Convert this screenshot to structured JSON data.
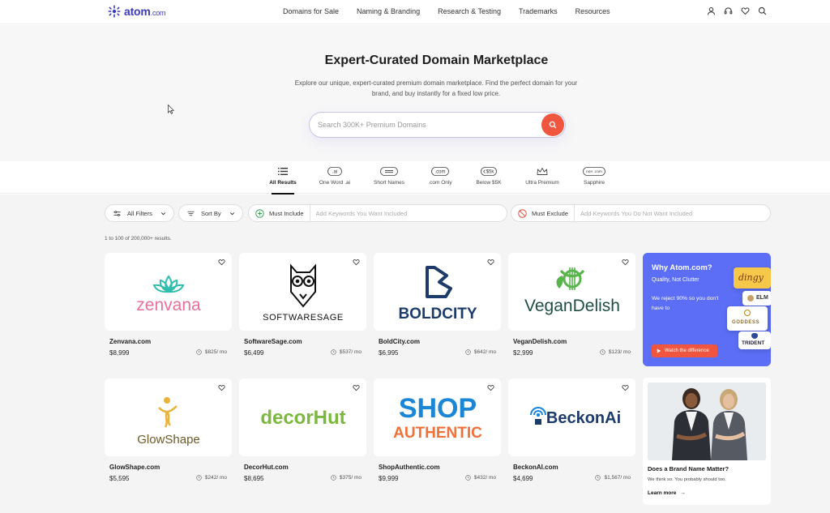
{
  "brand": {
    "name": "atom",
    "tld": ".com"
  },
  "nav": {
    "links": [
      "Domains for Sale",
      "Naming & Branding",
      "Research & Testing",
      "Trademarks",
      "Resources"
    ],
    "icons": [
      "user-icon",
      "headset-icon",
      "heart-icon",
      "search-icon"
    ]
  },
  "hero": {
    "title": "Expert-Curated Domain Marketplace",
    "subtitle": "Explore our unique, expert-curated premium domain marketplace. Find the perfect domain for your brand, and buy instantly for a fixed low price.",
    "search_placeholder": "Search 300K+ Premium Domains"
  },
  "tabs": [
    {
      "label": "All Results",
      "icon": "list-icon",
      "active": true
    },
    {
      "label": "One Word .ai",
      "icon": "ai-badge-icon",
      "badge": ".ai",
      "active": false
    },
    {
      "label": "Short Names",
      "icon": "short-name-icon",
      "active": false
    },
    {
      "label": ".com Only",
      "icon": "com-badge-icon",
      "badge": ".com",
      "active": false
    },
    {
      "label": "Below $5K",
      "icon": "price-tag-icon",
      "badge": "$5k",
      "active": false
    },
    {
      "label": "Ultra Premium",
      "icon": "crown-icon",
      "active": false
    },
    {
      "label": "Sapphire",
      "icon": "non-com-badge-icon",
      "badge": "non .com",
      "active": false
    }
  ],
  "filters": {
    "all_filters": "All Filters",
    "sort_by": "Sort By",
    "must_include": "Must Include",
    "include_placeholder": "Add Keywords You Want Included",
    "must_exclude": "Must Exclude",
    "exclude_placeholder": "Add Keywords You Do Not Want Included"
  },
  "results_count": "1 to 100 of 200,000+ results.",
  "cards": [
    {
      "name": "Zenvana.com",
      "price": "$8,999",
      "monthly": "$825/ mo",
      "logo_text": "zenvana"
    },
    {
      "name": "SoftwareSage.com",
      "price": "$6,499",
      "monthly": "$537/ mo",
      "logo_text": "SOFTWARESAGE"
    },
    {
      "name": "BoldCity.com",
      "price": "$6,995",
      "monthly": "$642/ mo",
      "logo_text": "BOLDCITY"
    },
    {
      "name": "VeganDelish.com",
      "price": "$2,999",
      "monthly": "$123/ mo",
      "logo_text": "VeganDelish"
    },
    {
      "name": "GlowShape.com",
      "price": "$5,595",
      "monthly": "$242/ mo",
      "logo_text": "GlowShape"
    },
    {
      "name": "DecorHut.com",
      "price": "$8,695",
      "monthly": "$375/ mo",
      "logo_text": "decorHut"
    },
    {
      "name": "ShopAuthentic.com",
      "price": "$9,999",
      "monthly": "$432/ mo",
      "logo_text_1": "SHOP",
      "logo_text_2": "AUTHENTIC"
    },
    {
      "name": "BeckonAI.com",
      "price": "$4,699",
      "monthly": "$1,567/ mo",
      "logo_text": "BeckonAi"
    }
  ],
  "promo": {
    "title": "Why Atom.com?",
    "subtitle": "Quality, Not Clutter",
    "body": "We reject 90% so you don't have to",
    "button": "Watch the difference",
    "mini_logos": [
      "dingy",
      "ELM",
      "GODDESS",
      "TRIDENT"
    ]
  },
  "article": {
    "title": "Does a Brand Name Matter?",
    "body": "We think so. You probably should too.",
    "link": "Learn more"
  },
  "colors": {
    "brand": "#3b3bb8",
    "accent": "#f0553f",
    "promo_bg": "#5b6ef5",
    "page_bg": "#f4f4f5"
  }
}
